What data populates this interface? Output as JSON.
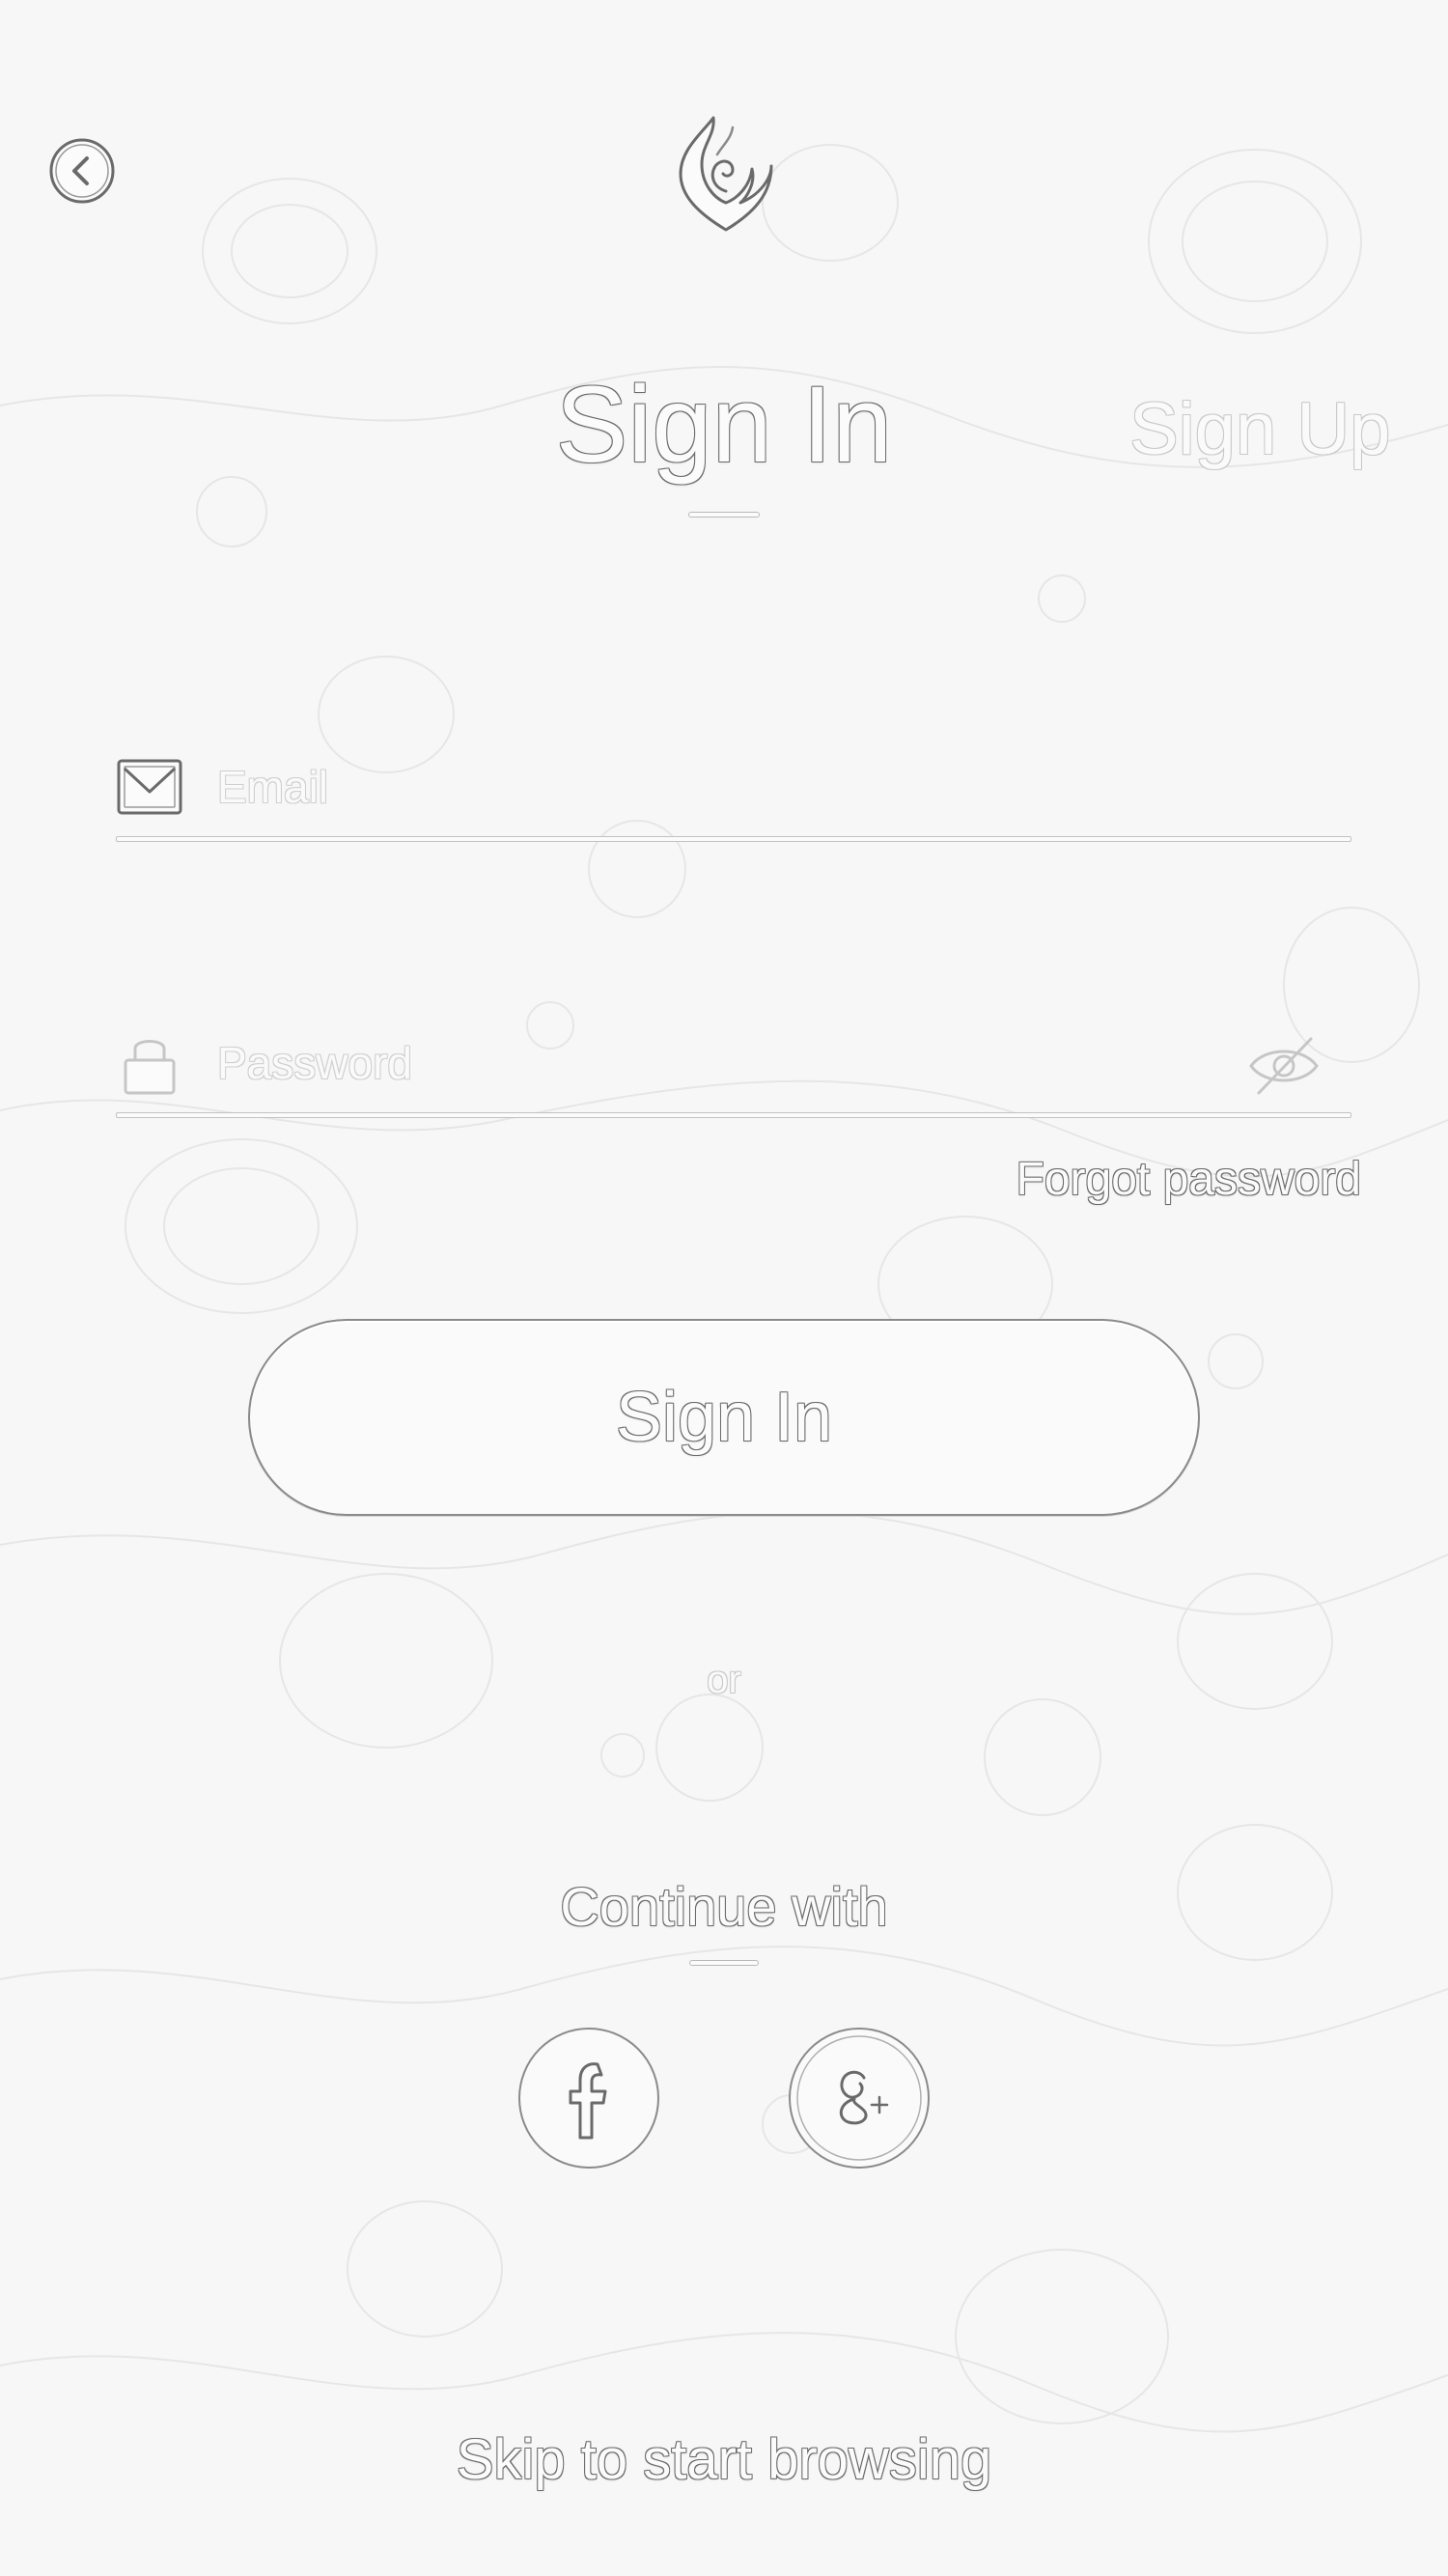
{
  "header": {
    "back_icon": "chevron-left-circle-icon",
    "logo_icon": "flame-logo-icon"
  },
  "tabs": {
    "signin_label": "Sign In",
    "signup_label": "Sign Up",
    "active": "signin"
  },
  "form": {
    "email": {
      "icon": "envelope-icon",
      "placeholder": "Email",
      "value": ""
    },
    "password": {
      "icon": "lock-icon",
      "placeholder": "Password",
      "value": "",
      "toggle_icon": "eye-slash-icon"
    },
    "forgot_label": "Forgot password",
    "submit_label": "Sign In"
  },
  "divider": {
    "or_label": "or"
  },
  "social": {
    "heading": "Continue with",
    "buttons": [
      {
        "name": "facebook",
        "icon": "facebook-icon",
        "glyph": "f"
      },
      {
        "name": "google-plus",
        "icon": "google-plus-icon",
        "glyph": "g+"
      }
    ]
  },
  "footer": {
    "skip_label": "Skip to start browsing"
  },
  "colors": {
    "background": "#f7f7f7",
    "outline": "#6a6a6a",
    "faint_outline": "#c9c9c9"
  }
}
